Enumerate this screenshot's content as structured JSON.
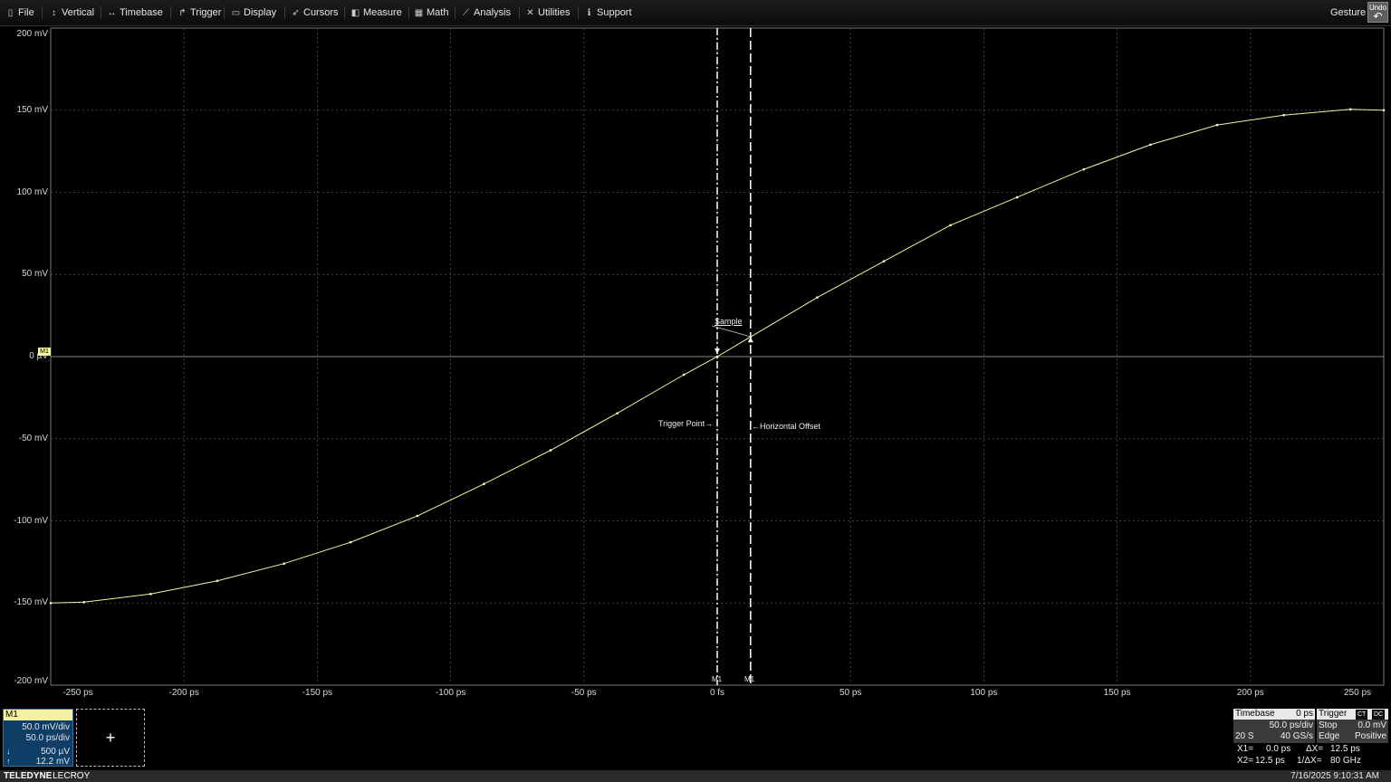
{
  "menu": {
    "items": [
      {
        "label": "File",
        "icon": "file-icon",
        "glyph": "▯"
      },
      {
        "label": "Vertical",
        "icon": "vertical-arrows-icon",
        "glyph": "↕"
      },
      {
        "label": "Timebase",
        "icon": "horizontal-arrows-icon",
        "glyph": "↔"
      },
      {
        "label": "Trigger",
        "icon": "trigger-icon",
        "glyph": "↱"
      },
      {
        "label": "Display",
        "icon": "display-icon",
        "glyph": "▭"
      },
      {
        "label": "Cursors",
        "icon": "cursors-icon",
        "glyph": "➶"
      },
      {
        "label": "Measure",
        "icon": "measure-icon",
        "glyph": "◧"
      },
      {
        "label": "Math",
        "icon": "math-icon",
        "glyph": "▦"
      },
      {
        "label": "Analysis",
        "icon": "analysis-icon",
        "glyph": "⟋"
      },
      {
        "label": "Utilities",
        "icon": "utilities-icon",
        "glyph": "✕"
      },
      {
        "label": "Support",
        "icon": "info-icon",
        "glyph": "ℹ"
      }
    ],
    "gesture": "Gesture",
    "undo": "Undo"
  },
  "grid": {
    "y_labels": [
      "200 mV",
      "150 mV",
      "100 mV",
      "50 mV",
      "0 µV",
      "-50 mV",
      "-100 mV",
      "-150 mV",
      "-200 mV"
    ],
    "x_labels": [
      "-250 ps",
      "-200 ps",
      "-150 ps",
      "-100 ps",
      "-50 ps",
      "0 fs",
      "50 ps",
      "100 ps",
      "150 ps",
      "200 ps",
      "250 ps"
    ],
    "trace_marker": "M1",
    "trace_color": "#f5f3a0"
  },
  "annotations": {
    "sample": "Sample",
    "trigger_point": "Trigger Point",
    "horizontal_offset": "Horizontal Offset",
    "cursor1_label": "M1",
    "cursor2_label": "M1"
  },
  "chart_data": {
    "type": "line",
    "xlabel": "",
    "ylabel": "",
    "xlim": [
      -250,
      250
    ],
    "ylim": [
      -200,
      200
    ],
    "x_unit": "ps",
    "y_unit": "mV",
    "grid": true,
    "series": [
      {
        "name": "M1",
        "x": [
          -250,
          -237.5,
          -212.5,
          -187.5,
          -162.5,
          -137.5,
          -112.5,
          -87.5,
          -62.5,
          -37.5,
          -12.5,
          0,
          12.5,
          37.5,
          62.5,
          87.5,
          112.5,
          137.5,
          162.5,
          187.5,
          212.5,
          237.5,
          250
        ],
        "y": [
          -150,
          -149.5,
          -144.5,
          -136.5,
          -126,
          -113,
          -97,
          -77.5,
          -57,
          -34.5,
          -11,
          0,
          12,
          36,
          58,
          80,
          97,
          114,
          129,
          141,
          147,
          150.5,
          150
        ]
      }
    ],
    "cursors": {
      "x1": 0,
      "x2": 12.5
    }
  },
  "m1_panel": {
    "title": "M1",
    "vdiv": "50.0 mV/div",
    "hdiv": "50.0 ps/div",
    "val1": "500 µV",
    "val2": "12.2 mV"
  },
  "add_button": "+",
  "timebase": {
    "title": "Timebase",
    "offset": "0 ps",
    "per_div": "50.0 ps/div",
    "samples": "20 S",
    "rate": "40 GS/s"
  },
  "trigger": {
    "title": "Trigger",
    "badge1": "CT",
    "badge2": "DC",
    "mode": "Stop",
    "level": "0.0 mV",
    "type": "Edge",
    "slope": "Positive"
  },
  "cursor_readout": {
    "x1": "X1=",
    "x1_val": "0.0 ps",
    "dx": "ΔX=",
    "dx_val": "12.5 ps",
    "x2": "X2=",
    "x2_val": "12.5 ps",
    "inv_dx": "1/ΔX=",
    "inv_dx_val": "80 GHz"
  },
  "footer": {
    "brand": "TELEDYNE",
    "brand2": "LECROY",
    "timestamp": "7/16/2025 9:10:31 AM"
  }
}
